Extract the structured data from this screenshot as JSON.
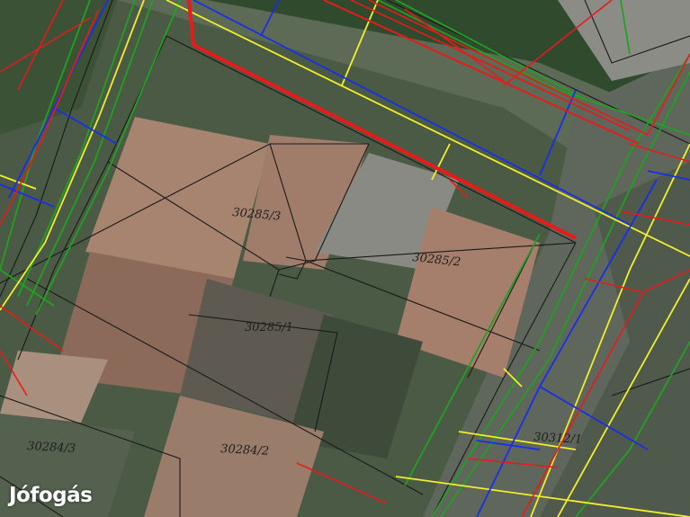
{
  "map": {
    "parcel_labels": [
      {
        "id": "p-30285-3",
        "text": "30285/3"
      },
      {
        "id": "p-30285-2",
        "text": "30285/2"
      },
      {
        "id": "p-30285-1",
        "text": "30285/1"
      },
      {
        "id": "p-30284-3",
        "text": "30284/3"
      },
      {
        "id": "p-30284-2",
        "text": "30284/2"
      },
      {
        "id": "p-30312-1",
        "text": "30312/1"
      }
    ],
    "colors": {
      "utility_red": "#e81a1a",
      "utility_blue": "#1a2ee8",
      "utility_yellow": "#f2ee2a",
      "utility_green": "#22a022",
      "parcel_boundary": "#1a1a1a"
    }
  },
  "watermark": {
    "logo_text": "Jófogás"
  }
}
